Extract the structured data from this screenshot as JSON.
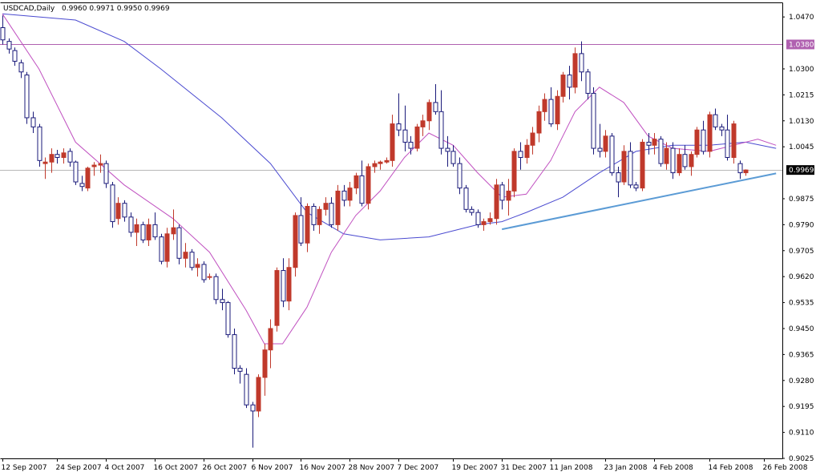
{
  "header": {
    "symbol_label": "USDCAD,Daily",
    "ohlc_label": "0.9960 0.9971 0.9950 0.9969"
  },
  "colors": {
    "background": "#ffffff",
    "axis": "#000000",
    "bull_candle": "#c0392b",
    "bear_candle": "#1a1a7a",
    "fast_ma": "#c050c0",
    "slow_ma": "#4a4ad0",
    "resistance_line": "#b060b0",
    "current_price_line": "#b8b8b8",
    "trendline": "#5b9bd5"
  },
  "chart_data": {
    "type": "candlestick",
    "title": "USDCAD,Daily",
    "ohlc_text": "0.9960 0.9971 0.9950 0.9969",
    "ylim": [
      0.9025,
      1.0515
    ],
    "y_ticks": [
      "1.0470",
      "1.0300",
      "1.0215",
      "1.0130",
      "1.0045",
      "0.9875",
      "0.9790",
      "0.9705",
      "0.9620",
      "0.9535",
      "0.9450",
      "0.9365",
      "0.9280",
      "0.9195",
      "0.9110",
      "0.9025"
    ],
    "x_ticks": [
      "12 Sep 2007",
      "24 Sep 2007",
      "4 Oct 2007",
      "16 Oct 2007",
      "26 Oct 2007",
      "6 Nov 2007",
      "16 Nov 2007",
      "28 Nov 2007",
      "7 Dec 2007",
      "19 Dec 2007",
      "31 Dec 2007",
      "11 Jan 2008",
      "23 Jan 2008",
      "4 Feb 2008",
      "14 Feb 2008",
      "26 Feb 2008"
    ],
    "x_tick_bar_index": [
      0,
      9,
      17,
      25,
      33,
      41,
      49,
      57,
      65,
      74,
      82,
      90,
      99,
      107,
      116,
      125
    ],
    "horizontal_levels": [
      {
        "label": "1.0380",
        "value": 1.038,
        "kind": "resistance"
      },
      {
        "label": "0.9969",
        "value": 0.9969,
        "kind": "current-price"
      }
    ],
    "trendline": {
      "from": {
        "bar": 82,
        "value": 0.9775
      },
      "to": {
        "bar": 127,
        "value": 0.9958
      }
    },
    "ohlc": [
      [
        1.0435,
        1.0475,
        1.038,
        1.0395
      ],
      [
        1.039,
        1.04,
        1.035,
        1.0365
      ],
      [
        1.036,
        1.037,
        1.031,
        1.0325
      ],
      [
        1.032,
        1.033,
        1.027,
        1.029
      ],
      [
        1.028,
        1.029,
        1.012,
        1.014
      ],
      [
        1.014,
        1.016,
        1.009,
        1.011
      ],
      [
        1.011,
        1.012,
        0.998,
        1.0
      ],
      [
        0.999,
        1.001,
        0.994,
        0.9995
      ],
      [
        0.9995,
        1.004,
        0.996,
        1.002
      ],
      [
        1.002,
        1.0035,
        0.999,
        1.001
      ],
      [
        1.001,
        1.004,
        0.999,
        1.0025
      ],
      [
        1.003,
        1.004,
        0.998,
        0.9995
      ],
      [
        0.9995,
        1.0,
        0.992,
        0.993
      ],
      [
        0.9925,
        0.995,
        0.99,
        0.9915
      ],
      [
        0.991,
        0.998,
        0.99,
        0.9975
      ],
      [
        0.998,
        0.9995,
        0.995,
        0.9985
      ],
      [
        0.9985,
        1.002,
        0.996,
        0.999
      ],
      [
        0.999,
        1.0,
        0.991,
        0.9925
      ],
      [
        0.992,
        0.993,
        0.978,
        0.98
      ],
      [
        0.981,
        0.988,
        0.979,
        0.986
      ],
      [
        0.986,
        0.987,
        0.98,
        0.9815
      ],
      [
        0.9815,
        0.983,
        0.975,
        0.9765
      ],
      [
        0.9765,
        0.981,
        0.972,
        0.979
      ],
      [
        0.979,
        0.98,
        0.973,
        0.974
      ],
      [
        0.974,
        0.981,
        0.972,
        0.979
      ],
      [
        0.979,
        0.983,
        0.974,
        0.975
      ],
      [
        0.975,
        0.976,
        0.966,
        0.967
      ],
      [
        0.967,
        0.978,
        0.965,
        0.976
      ],
      [
        0.976,
        0.984,
        0.974,
        0.978
      ],
      [
        0.978,
        0.979,
        0.966,
        0.968
      ],
      [
        0.968,
        0.973,
        0.965,
        0.97
      ],
      [
        0.97,
        0.971,
        0.964,
        0.965
      ],
      [
        0.965,
        0.968,
        0.962,
        0.966
      ],
      [
        0.966,
        0.967,
        0.96,
        0.961
      ],
      [
        0.962,
        0.963,
        0.961,
        0.962
      ],
      [
        0.962,
        0.963,
        0.953,
        0.9545
      ],
      [
        0.9545,
        0.958,
        0.951,
        0.9535
      ],
      [
        0.9535,
        0.954,
        0.942,
        0.943
      ],
      [
        0.943,
        0.945,
        0.93,
        0.932
      ],
      [
        0.932,
        0.933,
        0.927,
        0.931
      ],
      [
        0.93,
        0.932,
        0.919,
        0.92
      ],
      [
        0.92,
        0.921,
        0.906,
        0.918
      ],
      [
        0.918,
        0.93,
        0.916,
        0.929
      ],
      [
        0.929,
        0.94,
        0.923,
        0.938
      ],
      [
        0.938,
        0.948,
        0.932,
        0.945
      ],
      [
        0.946,
        0.965,
        0.944,
        0.964
      ],
      [
        0.964,
        0.968,
        0.952,
        0.954
      ],
      [
        0.954,
        0.968,
        0.951,
        0.965
      ],
      [
        0.965,
        0.983,
        0.962,
        0.982
      ],
      [
        0.982,
        0.988,
        0.972,
        0.973
      ],
      [
        0.973,
        0.986,
        0.97,
        0.985
      ],
      [
        0.985,
        0.986,
        0.977,
        0.979
      ],
      [
        0.979,
        0.985,
        0.976,
        0.984
      ],
      [
        0.984,
        0.988,
        0.982,
        0.986
      ],
      [
        0.986,
        0.988,
        0.978,
        0.979
      ],
      [
        0.979,
        0.992,
        0.977,
        0.99
      ],
      [
        0.99,
        0.992,
        0.985,
        0.987
      ],
      [
        0.987,
        0.993,
        0.985,
        0.991
      ],
      [
        0.991,
        0.996,
        0.989,
        0.995
      ],
      [
        0.995,
        1.0,
        0.985,
        0.986
      ],
      [
        0.986,
        0.999,
        0.984,
        0.998
      ],
      [
        0.998,
        1.0,
        0.996,
        0.999
      ],
      [
        0.999,
        1.0,
        0.997,
        0.9995
      ],
      [
        0.9995,
        1.001,
        0.999,
        1.0
      ],
      [
        1.0,
        1.015,
        0.998,
        1.012
      ],
      [
        1.012,
        1.022,
        1.008,
        1.01
      ],
      [
        1.01,
        1.018,
        1.003,
        1.006
      ],
      [
        1.006,
        1.008,
        1.002,
        1.004
      ],
      [
        1.004,
        1.012,
        1.003,
        1.011
      ],
      [
        1.011,
        1.015,
        1.008,
        1.013
      ],
      [
        1.013,
        1.02,
        1.01,
        1.019
      ],
      [
        1.019,
        1.025,
        1.015,
        1.016
      ],
      [
        1.016,
        1.023,
        1.002,
        1.004
      ],
      [
        1.004,
        1.008,
        0.998,
        1.003
      ],
      [
        1.003,
        1.005,
        0.998,
        0.999
      ],
      [
        0.999,
        1.001,
        0.989,
        0.991
      ],
      [
        0.991,
        0.992,
        0.983,
        0.984
      ],
      [
        0.984,
        0.985,
        0.982,
        0.983
      ],
      [
        0.983,
        0.984,
        0.978,
        0.979
      ],
      [
        0.979,
        0.981,
        0.977,
        0.98
      ],
      [
        0.98,
        0.983,
        0.979,
        0.981
      ],
      [
        0.981,
        0.994,
        0.979,
        0.992
      ],
      [
        0.992,
        0.993,
        0.984,
        0.987
      ],
      [
        0.987,
        0.994,
        0.982,
        0.99
      ],
      [
        0.99,
        1.004,
        0.988,
        1.003
      ],
      [
        1.003,
        1.006,
        0.997,
        1.001
      ],
      [
        1.001,
        1.007,
        0.999,
        1.005
      ],
      [
        1.005,
        1.011,
        1.002,
        1.009
      ],
      [
        1.009,
        1.018,
        1.006,
        1.016
      ],
      [
        1.016,
        1.022,
        1.013,
        1.02
      ],
      [
        1.02,
        1.024,
        1.011,
        1.012
      ],
      [
        1.012,
        1.023,
        1.01,
        1.021
      ],
      [
        1.021,
        1.029,
        1.019,
        1.028
      ],
      [
        1.028,
        1.031,
        1.02,
        1.024
      ],
      [
        1.024,
        1.037,
        1.022,
        1.035
      ],
      [
        1.035,
        1.039,
        1.026,
        1.029
      ],
      [
        1.029,
        1.03,
        1.02,
        1.022
      ],
      [
        1.022,
        1.024,
        1.002,
        1.004
      ],
      [
        1.004,
        1.012,
        1.001,
        1.003
      ],
      [
        1.003,
        1.01,
        1.001,
        1.008
      ],
      [
        1.008,
        1.009,
        0.995,
        0.996
      ],
      [
        0.996,
        0.998,
        0.988,
        0.993
      ],
      [
        0.993,
        1.005,
        0.992,
        1.003
      ],
      [
        1.003,
        1.006,
        0.991,
        0.992
      ],
      [
        0.992,
        0.993,
        0.99,
        0.991
      ],
      [
        0.991,
        1.007,
        0.99,
        1.006
      ],
      [
        1.006,
        1.009,
        1.002,
        1.005
      ],
      [
        1.005,
        1.009,
        1.002,
        1.007
      ],
      [
        1.007,
        1.008,
        0.998,
        0.999
      ],
      [
        0.999,
        1.006,
        0.997,
        1.004
      ],
      [
        1.004,
        1.006,
        0.994,
        0.996
      ],
      [
        0.996,
        1.004,
        0.995,
        1.002
      ],
      [
        1.002,
        1.005,
        0.997,
        0.998
      ],
      [
        0.998,
        1.003,
        0.995,
        1.002
      ],
      [
        1.002,
        1.011,
        1.001,
        1.01
      ],
      [
        1.01,
        1.013,
        1.002,
        1.003
      ],
      [
        1.003,
        1.016,
        1.001,
        1.015
      ],
      [
        1.015,
        1.017,
        1.01,
        1.011
      ],
      [
        1.011,
        1.012,
        1.008,
        1.01
      ],
      [
        1.01,
        1.015,
        1.0,
        1.001
      ],
      [
        1.001,
        1.013,
        0.999,
        1.012
      ],
      [
        0.999,
        1.0,
        0.994,
        0.996
      ],
      [
        0.996,
        0.9971,
        0.995,
        0.9969
      ]
    ],
    "fast_ma": [
      [
        0,
        1.048
      ],
      [
        6,
        1.03
      ],
      [
        12,
        1.006
      ],
      [
        20,
        0.992
      ],
      [
        28,
        0.981
      ],
      [
        34,
        0.97
      ],
      [
        40,
        0.951
      ],
      [
        43,
        0.94
      ],
      [
        46,
        0.94
      ],
      [
        50,
        0.952
      ],
      [
        54,
        0.97
      ],
      [
        58,
        0.982
      ],
      [
        62,
        0.99
      ],
      [
        66,
        1.001
      ],
      [
        70,
        1.009
      ],
      [
        74,
        1.005
      ],
      [
        78,
        0.996
      ],
      [
        82,
        0.988
      ],
      [
        86,
        0.989
      ],
      [
        90,
        1.0
      ],
      [
        94,
        1.016
      ],
      [
        98,
        1.024
      ],
      [
        102,
        1.019
      ],
      [
        106,
        1.008
      ],
      [
        110,
        1.004
      ],
      [
        116,
        1.003
      ],
      [
        120,
        1.005
      ],
      [
        124,
        1.007
      ],
      [
        127,
        1.005
      ]
    ],
    "slow_ma": [
      [
        0,
        1.048
      ],
      [
        12,
        1.046
      ],
      [
        20,
        1.039
      ],
      [
        26,
        1.03
      ],
      [
        36,
        1.014
      ],
      [
        44,
        0.999
      ],
      [
        50,
        0.983
      ],
      [
        56,
        0.976
      ],
      [
        62,
        0.974
      ],
      [
        70,
        0.975
      ],
      [
        78,
        0.979
      ],
      [
        82,
        0.98
      ],
      [
        86,
        0.983
      ],
      [
        92,
        0.988
      ],
      [
        98,
        0.996
      ],
      [
        104,
        1.003
      ],
      [
        110,
        1.005
      ],
      [
        116,
        1.005
      ],
      [
        122,
        1.006
      ],
      [
        127,
        1.004
      ]
    ]
  }
}
